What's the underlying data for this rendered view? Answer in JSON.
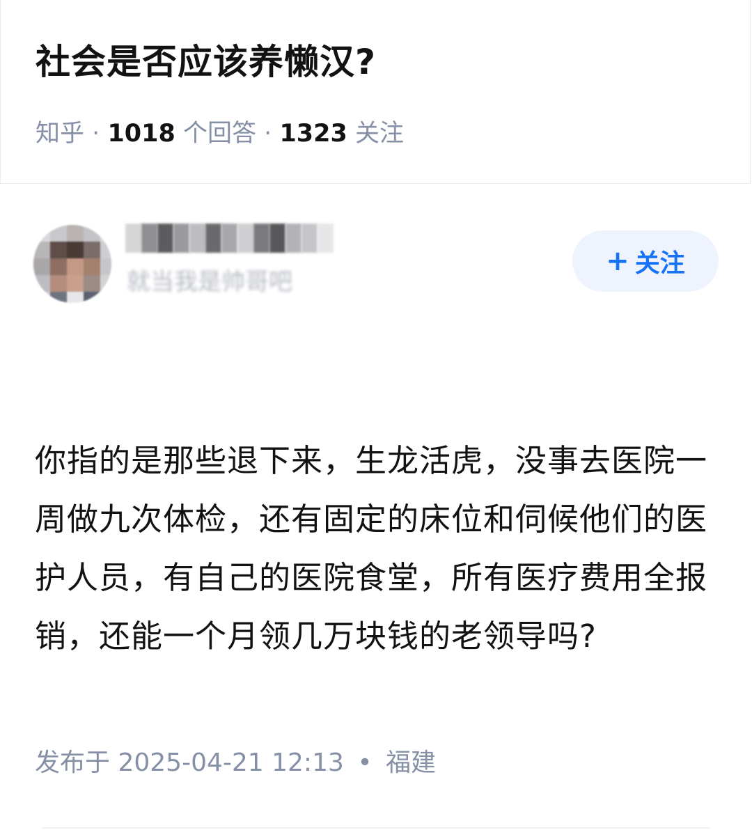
{
  "question": {
    "title": "社会是否应该养懒汉?",
    "source": "知乎",
    "answer_count": "1018",
    "answer_unit": "个回答",
    "follower_count": "1323",
    "follower_unit": "关注",
    "separator": "·"
  },
  "author": {
    "bio": "就当我是帅哥吧",
    "follow_label": "关注",
    "follow_icon": "plus-icon"
  },
  "answer": {
    "text": "你指的是那些退下来，生龙活虎，没事去医院一周做九次体检，还有固定的床位和伺候他们的医护人员，有自己的医院食堂，所有医疗费用全报销，还能一个月领几万块钱的老领导吗?",
    "published_label": "发布于",
    "published_time": "2025-04-21 12:13",
    "dot": "•",
    "location": "福建"
  },
  "colors": {
    "accent": "#1772f6",
    "follow_bg": "#eef3fd",
    "meta_gray": "#8590a6",
    "text": "#121212"
  }
}
